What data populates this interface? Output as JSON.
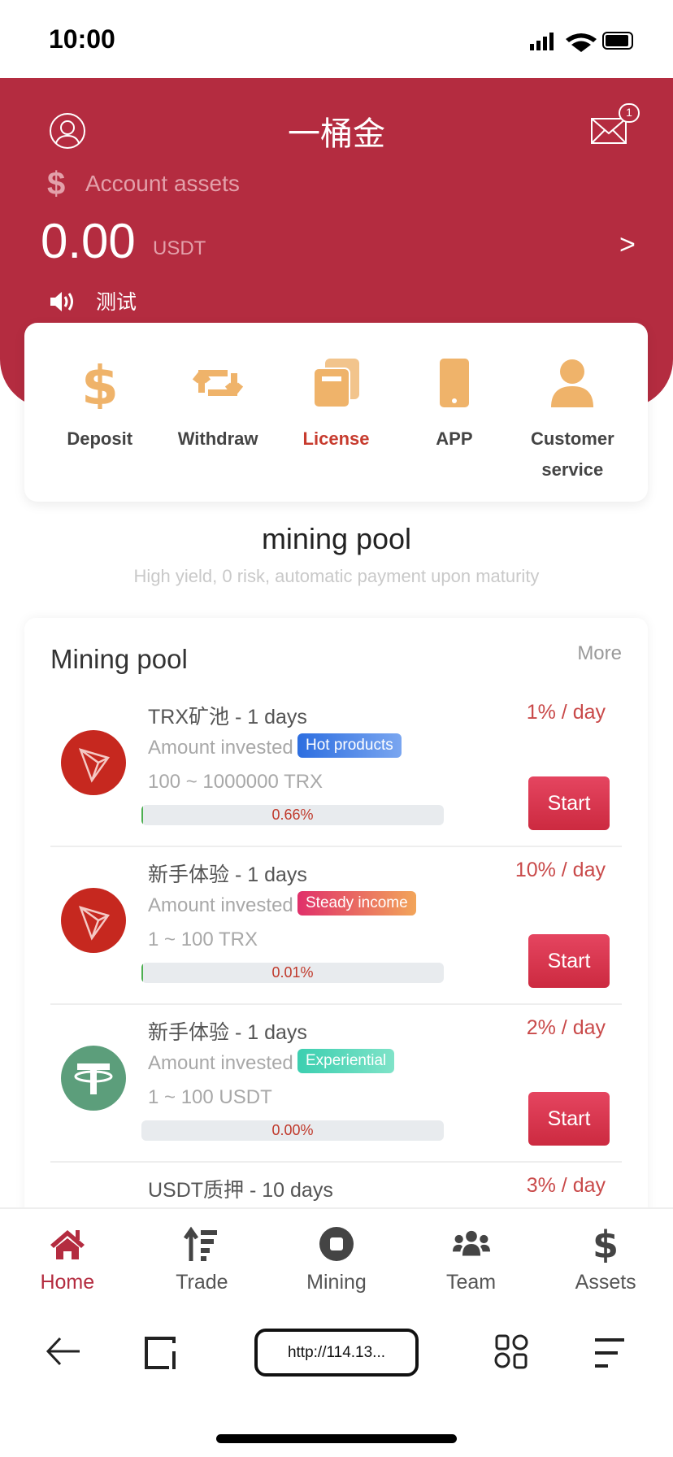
{
  "status_bar": {
    "time": "10:00"
  },
  "header": {
    "title": "一桶金",
    "account_label": "Account assets",
    "amount": "0.00",
    "unit": "USDT",
    "arrow": ">",
    "notice": "测试",
    "message_badge": "1"
  },
  "colors": {
    "brand": "#b42c40",
    "icon_gold": "#efb36a",
    "rate": "#c94a4a"
  },
  "quick_actions": [
    {
      "label": "Deposit",
      "icon": "dollar-icon"
    },
    {
      "label": "Withdraw",
      "icon": "transfer-icon"
    },
    {
      "label": "License",
      "icon": "cards-icon",
      "active": true
    },
    {
      "label": "APP",
      "icon": "phone-icon"
    },
    {
      "label": "Customer service",
      "icon": "person-icon"
    }
  ],
  "section": {
    "title": "mining pool",
    "subtitle": "High yield, 0 risk, automatic payment upon maturity"
  },
  "pool": {
    "title": "Mining pool",
    "more": "More",
    "amount_label": "Amount invested",
    "start_label": "Start",
    "items": [
      {
        "name": "TRX矿池 - 1 days",
        "rate": "1% / day",
        "tag": "Hot products",
        "range": "100 ~ 1000000 TRX",
        "progress": "0.66%",
        "progress_value": 0.66,
        "coin": "TRX"
      },
      {
        "name": "新手体验 - 1 days",
        "rate": "10% / day",
        "tag": "Steady income",
        "range": "1 ~ 100 TRX",
        "progress": "0.01%",
        "progress_value": 0.01,
        "coin": "TRX"
      },
      {
        "name": "新手体验 - 1 days",
        "rate": "2% / day",
        "tag": "Experiential",
        "range": "1 ~ 100 USDT",
        "progress": "0.00%",
        "progress_value": 0,
        "coin": "USDT"
      },
      {
        "name": "USDT质押 - 10 days",
        "rate": "3% / day"
      }
    ]
  },
  "tabbar": [
    {
      "label": "Home",
      "active": true
    },
    {
      "label": "Trade"
    },
    {
      "label": "Mining"
    },
    {
      "label": "Team"
    },
    {
      "label": "Assets"
    }
  ],
  "browser": {
    "url": "http://114.13..."
  }
}
